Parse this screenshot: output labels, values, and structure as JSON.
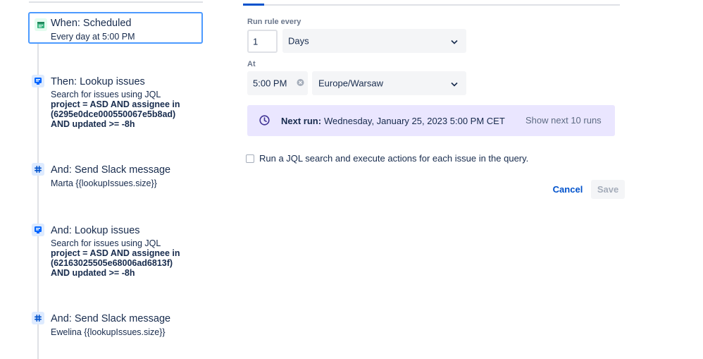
{
  "steps": [
    {
      "title": "When: Scheduled",
      "subtitle": "Every day at 5:00 PM",
      "icon": "calendar-icon"
    },
    {
      "title": "Then: Lookup issues",
      "subtitle": "Search for issues using JQL",
      "jql": [
        "project = ASD AND assignee in",
        "(6295e0dce000550067e5b8ad)",
        "AND updated >= -8h"
      ],
      "icon": "lookup-icon"
    },
    {
      "title": "And: Send Slack message",
      "subtitle": "Marta {{lookupIssues.size}}",
      "icon": "slack-icon"
    },
    {
      "title": "And: Lookup issues",
      "subtitle": "Search for issues using JQL",
      "jql": [
        "project = ASD AND assignee in",
        "(62163025505e68006ad6813f)",
        "AND updated >= -8h"
      ],
      "icon": "lookup-icon"
    },
    {
      "title": "And: Send Slack message",
      "subtitle": "Ewelina {{lookupIssues.size}}",
      "icon": "slack-icon"
    }
  ],
  "form": {
    "run_rule_label": "Run rule every",
    "interval_value": "1",
    "interval_unit": "Days",
    "at_label": "At",
    "time_value": "5:00 PM",
    "timezone": "Europe/Warsaw",
    "next_run_label": "Next run:",
    "next_run_value": "Wednesday, January 25, 2023 5:00 PM CET",
    "show_next_runs": "Show next 10 runs",
    "jql_checkbox_label": "Run a JQL search and execute actions for each issue in the query.",
    "jql_checkbox_checked": false,
    "cancel_label": "Cancel",
    "save_label": "Save"
  },
  "colors": {
    "accent": "#0052cc",
    "selected_border": "#4c9aff",
    "banner_bg": "#eae6ff",
    "field_bg": "#f4f5f7",
    "schedule_icon": "#36b37e"
  }
}
